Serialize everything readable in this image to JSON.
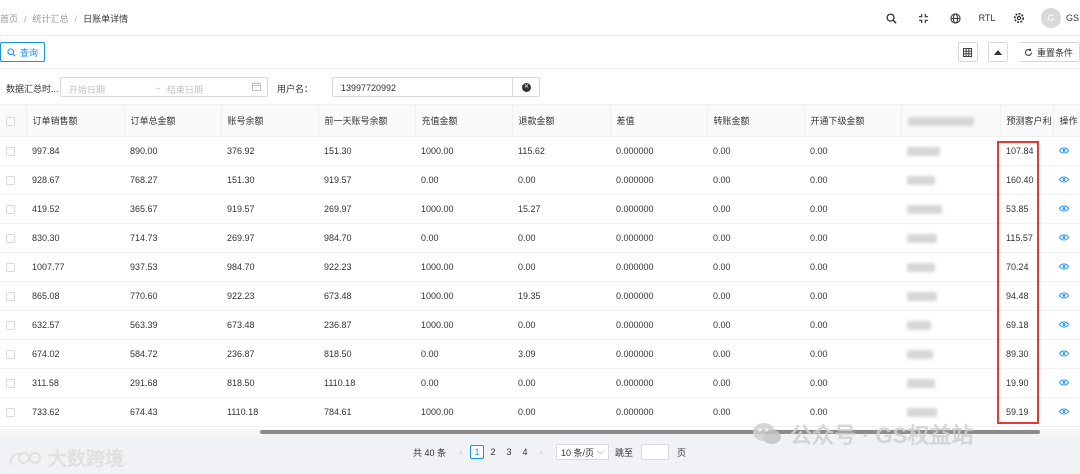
{
  "breadcrumb": [
    "首页",
    "统计汇总",
    "日账单详情"
  ],
  "header": {
    "rtl_label": "RTL",
    "avatar_initial": "G",
    "username": "GS"
  },
  "toolbar": {
    "query_label": "查询",
    "reset_label": "重置条件"
  },
  "filters": {
    "date_label": "数据汇总时...",
    "start_placeholder": "开始日期",
    "end_placeholder": "结束日期",
    "arrow": "→",
    "user_label": "用户名：",
    "user_value": "13997720992"
  },
  "table": {
    "columns": [
      "订单销售额",
      "订单总金额",
      "账号余额",
      "前一天账号余额",
      "充值金额",
      "退款金额",
      "差值",
      "转账金额",
      "开通下级金额",
      "",
      "预测客户利",
      "操作"
    ],
    "rows": [
      [
        "997.84",
        "890.00",
        "376.92",
        "151.30",
        "1000.00",
        "115.62",
        "0.000000",
        "0.00",
        "0.00",
        "",
        "107.84"
      ],
      [
        "928.67",
        "768.27",
        "151.30",
        "919.57",
        "0.00",
        "0.00",
        "0.000000",
        "0.00",
        "0.00",
        "",
        "160.40"
      ],
      [
        "419.52",
        "365.67",
        "919.57",
        "269.97",
        "1000.00",
        "15.27",
        "0.000000",
        "0.00",
        "0.00",
        "",
        "53.85"
      ],
      [
        "830.30",
        "714.73",
        "269.97",
        "984.70",
        "0.00",
        "0.00",
        "0.000000",
        "0.00",
        "0.00",
        "",
        "115.57"
      ],
      [
        "1007.77",
        "937.53",
        "984.70",
        "922.23",
        "1000.00",
        "0.00",
        "0.000000",
        "0.00",
        "0.00",
        "",
        "70.24"
      ],
      [
        "865.08",
        "770.60",
        "922.23",
        "673.48",
        "1000.00",
        "19.35",
        "0.000000",
        "0.00",
        "0.00",
        "",
        "94.48"
      ],
      [
        "632.57",
        "563.39",
        "673.48",
        "236.87",
        "1000.00",
        "0.00",
        "0.000000",
        "0.00",
        "0.00",
        "",
        "69.18"
      ],
      [
        "674.02",
        "584.72",
        "236.87",
        "818.50",
        "0.00",
        "3.09",
        "0.000000",
        "0.00",
        "0.00",
        "",
        "89.30"
      ],
      [
        "311.58",
        "291.68",
        "818.50",
        "1110.18",
        "0.00",
        "0.00",
        "0.000000",
        "0.00",
        "0.00",
        "",
        "19.90"
      ],
      [
        "733.62",
        "674.43",
        "1110.18",
        "784.61",
        "1000.00",
        "0.00",
        "0.000000",
        "0.00",
        "0.00",
        "",
        "59.19"
      ]
    ]
  },
  "pagination": {
    "total_text": "共 40 条",
    "prev": "‹",
    "next": "›",
    "pages": [
      "1",
      "2",
      "3",
      "4"
    ],
    "page_size": "10 条/页",
    "jump_label": "跳至",
    "page_unit": "页"
  },
  "watermarks": {
    "left": "大数跨境",
    "right": "公众号 · GS权益站"
  },
  "colors": {
    "primary": "#1890ff",
    "highlight": "#e53935"
  }
}
